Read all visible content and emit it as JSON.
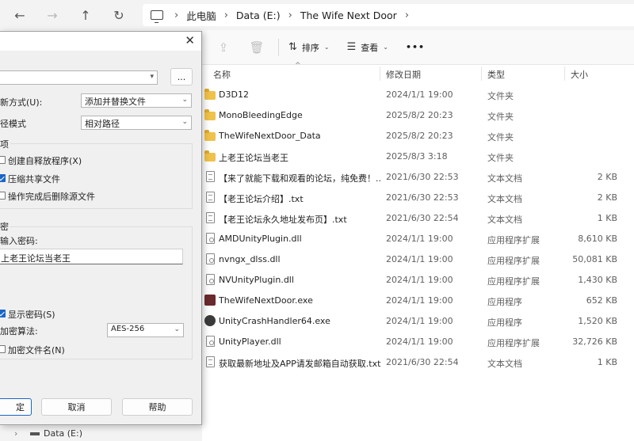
{
  "nav": {
    "back_icon": "←",
    "forward_icon": "→",
    "up_icon": "↑",
    "refresh_icon": "↻"
  },
  "breadcrumb": {
    "sep": "›",
    "items": [
      "此电脑",
      "Data (E:)",
      "The Wife Next Door"
    ]
  },
  "toolbar": {
    "share_icon": "⇪",
    "delete_icon": "🗑",
    "sort_label": "排序",
    "view_label": "查看",
    "more_label": "•••",
    "caret": "⌄"
  },
  "columns": {
    "sort_indicator": "^",
    "name": "名称",
    "date": "修改日期",
    "type": "类型",
    "size": "大小"
  },
  "files": [
    {
      "icon": "folder",
      "name": "D3D12",
      "date": "2024/1/1 19:00",
      "type": "文件夹",
      "size": ""
    },
    {
      "icon": "folder",
      "name": "MonoBleedingEdge",
      "date": "2025/8/2 20:23",
      "type": "文件夹",
      "size": ""
    },
    {
      "icon": "folder",
      "name": "TheWifeNextDoor_Data",
      "date": "2025/8/2 20:23",
      "type": "文件夹",
      "size": ""
    },
    {
      "icon": "folder",
      "name": "上老王论坛当老王",
      "date": "2025/8/3 3:18",
      "type": "文件夹",
      "size": ""
    },
    {
      "icon": "doc",
      "name": "【来了就能下载和观看的论坛，纯免费！...",
      "date": "2021/6/30 22:53",
      "type": "文本文档",
      "size": "2 KB"
    },
    {
      "icon": "doc",
      "name": "【老王论坛介绍】.txt",
      "date": "2021/6/30 22:53",
      "type": "文本文档",
      "size": "2 KB"
    },
    {
      "icon": "doc",
      "name": "【老王论坛永久地址发布页】.txt",
      "date": "2021/6/30 22:54",
      "type": "文本文档",
      "size": "1 KB"
    },
    {
      "icon": "dll",
      "name": "AMDUnityPlugin.dll",
      "date": "2024/1/1 19:00",
      "type": "应用程序扩展",
      "size": "8,610 KB"
    },
    {
      "icon": "dll",
      "name": "nvngx_dlss.dll",
      "date": "2024/1/1 19:00",
      "type": "应用程序扩展",
      "size": "50,081 KB"
    },
    {
      "icon": "dll",
      "name": "NVUnityPlugin.dll",
      "date": "2024/1/1 19:00",
      "type": "应用程序扩展",
      "size": "1,430 KB"
    },
    {
      "icon": "exe",
      "name": "TheWifeNextDoor.exe",
      "date": "2024/1/1 19:00",
      "type": "应用程序",
      "size": "652 KB"
    },
    {
      "icon": "unity",
      "name": "UnityCrashHandler64.exe",
      "date": "2024/1/1 19:00",
      "type": "应用程序",
      "size": "1,520 KB"
    },
    {
      "icon": "dll",
      "name": "UnityPlayer.dll",
      "date": "2024/1/1 19:00",
      "type": "应用程序扩展",
      "size": "32,726 KB"
    },
    {
      "icon": "doc",
      "name": "获取最新地址及APP请发邮箱自动获取.txt",
      "date": "2021/6/30 22:54",
      "type": "文本文档",
      "size": "1 KB"
    }
  ],
  "navpane": {
    "chevron": "›",
    "drive_label": "Data (E:)"
  },
  "dialog": {
    "close_icon": "✕",
    "browse_label": "...",
    "update_mode_label": "新方式(U):",
    "update_mode_value": "添加并替换文件",
    "path_mode_label": "径模式",
    "path_mode_value": "相对路径",
    "options_title": "项",
    "opt_sfx": "创建自释放程序(X)",
    "opt_shared": "压缩共享文件",
    "opt_delete": "操作完成后删除源文件",
    "encryption_title": "密",
    "password_label": "输入密码:",
    "password_value": "上老王论坛当老王",
    "show_password": "显示密码(S)",
    "enc_method_label": "加密算法:",
    "enc_method_value": "AES-256",
    "enc_names": "加密文件名(N)",
    "ok_label": "定",
    "cancel_label": "取消",
    "help_label": "帮助"
  }
}
